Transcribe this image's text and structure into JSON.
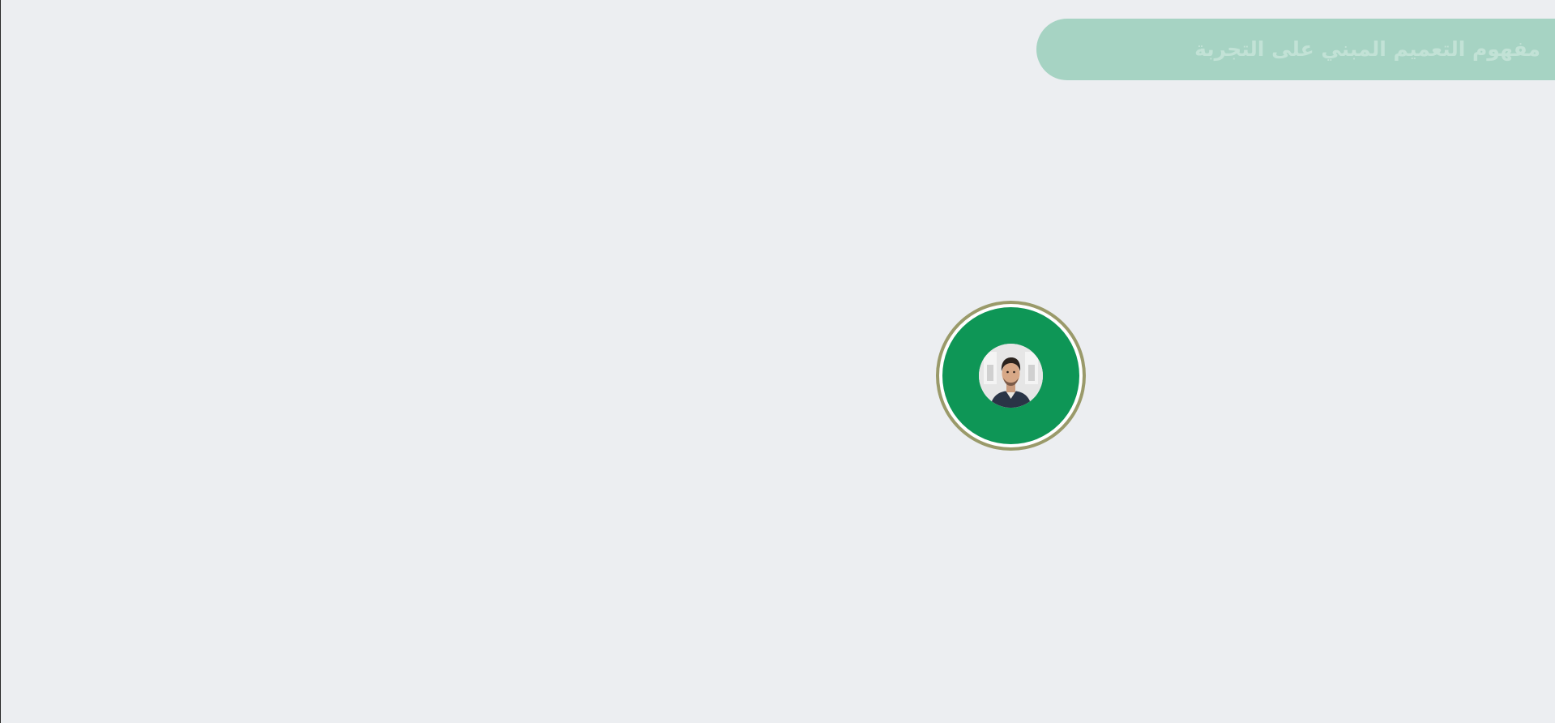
{
  "header": {
    "title": "مفهوم التعميم المبني على التجربة"
  },
  "presenter": {
    "icon": "person-avatar-icon"
  },
  "colors": {
    "background": "#eceef1",
    "title_pill": "#a6d3c3",
    "title_text": "#c2e2d6",
    "avatar_ring": "#0e9656",
    "avatar_border": "#9a9a6a"
  }
}
